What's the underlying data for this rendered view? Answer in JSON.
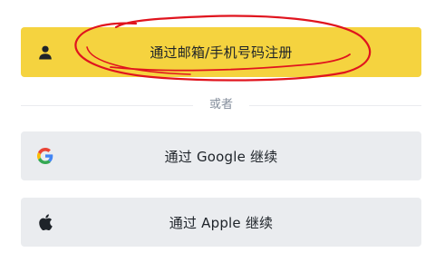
{
  "auth": {
    "email_phone_label": "通过邮箱/手机号码注册",
    "divider_text": "或者",
    "google_label": "通过 Google 继续",
    "apple_label": "通过 Apple 继续"
  },
  "colors": {
    "primary_button": "#f5d33f",
    "secondary_button": "#eaecef",
    "annotation_stroke": "#e0141e",
    "google_blue": "#4285F4",
    "google_red": "#EA4335",
    "google_yellow": "#FBBC05",
    "google_green": "#34A853"
  },
  "icons": {
    "email_phone": "user-icon",
    "google": "google-logo-icon",
    "apple": "apple-logo-icon"
  }
}
